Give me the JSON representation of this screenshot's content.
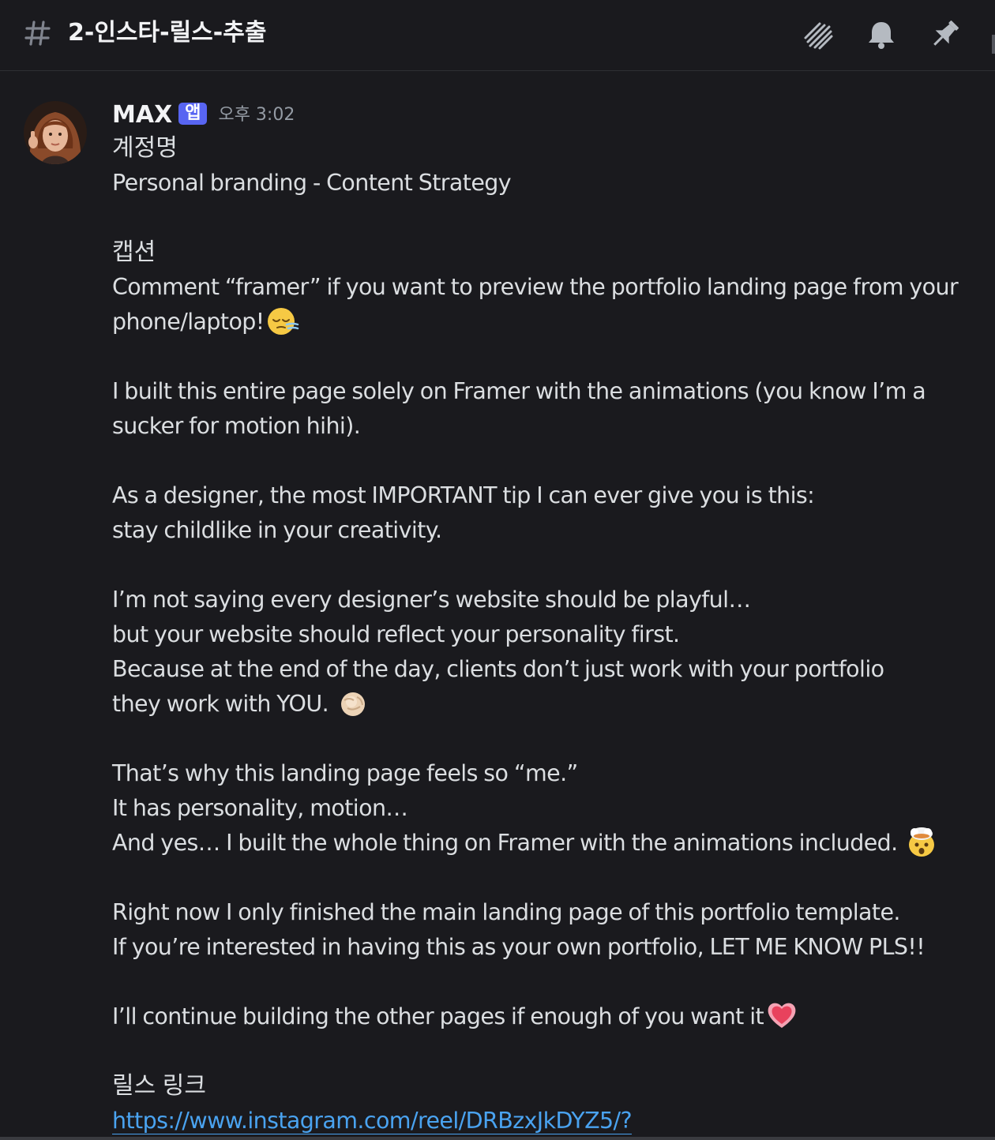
{
  "channel": {
    "name": "2-인스타-릴스-추출"
  },
  "header_icons": [
    "threads-icon",
    "bell-icon",
    "pin-icon"
  ],
  "message": {
    "author": "MAX",
    "badge": "앱",
    "timestamp": "오후 3:02",
    "lines": [
      "계정명",
      "Personal branding - Content Strategy",
      "",
      "캡션",
      "Comment “framer” if you want to preview the portfolio landing page from your",
      "phone/laptop!",
      "",
      "I built this entire page solely on Framer with the animations (you know I’m a",
      "sucker for motion hihi).",
      "",
      "As a designer, the most IMPORTANT tip I can ever give you is this:",
      "stay childlike in your creativity.",
      "",
      "I’m not saying every designer’s website should be playful…",
      "but your website should reflect your personality first.",
      "Because at the end of the day, clients don’t just work with your portfolio",
      "they work with YOU. ",
      "",
      "That’s why this landing page feels so “me.”",
      "It has personality, motion…",
      "And yes… I built the whole thing on Framer with the animations included. ",
      "",
      "Right now I only finished the main landing page of this portfolio template.",
      "If you’re interested in having this as your own portfolio, LET ME KNOW PLS!!",
      "",
      "I’ll continue building the other pages if enough of you want it",
      "",
      "릴스 링크"
    ],
    "link": "https://www.instagram.com/reel/DRBzxJkDYZ5/?"
  },
  "emojis": [
    "sleeping-face-emoji",
    "pointing-at-viewer-emoji",
    "exploding-head-emoji",
    "heart-emoji"
  ],
  "colors": {
    "background": "#1a1a1e",
    "text": "#dbdee1",
    "muted": "#949ba4",
    "badge": "#5865f2",
    "link": "#4aa3f0"
  }
}
